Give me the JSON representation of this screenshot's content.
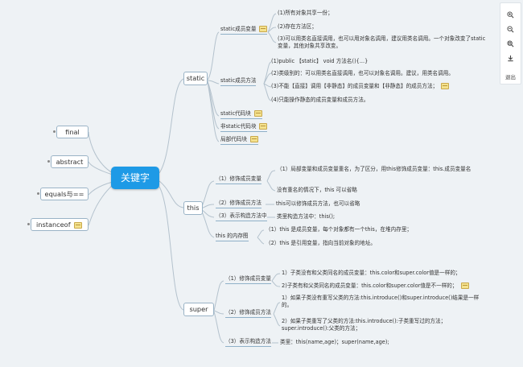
{
  "central": "关键字",
  "left_topics": [
    "final",
    "abstract",
    "equals与==",
    "instanceof"
  ],
  "static": {
    "label": "static",
    "member_var": {
      "label": "static成员变量",
      "items": [
        "(1)所有对象共享一份；",
        "(2)存在方法区；",
        "(3)可以用类名直接调用，也可以用对象名调用，建议用类名调用。一个对象改变了static变量，其他对象共享改变。"
      ]
    },
    "member_method": {
      "label": "static成员方法",
      "items": [
        "(1)public 【static】 void 方法名(){...}",
        "(2)类级别的：可以用类名直接调用，也可以对象名调用。建议，用类名调用。",
        "(3)不能【直接】调用【非静态】的成员变量和【非静态】的成员方法；",
        "(4)只能操作静态的成员变量和成员方法。"
      ]
    },
    "code_block": "static代码块",
    "nonstatic_block": "非static代码块",
    "local_block": "局部代码块"
  },
  "this": {
    "label": "this",
    "modify_var": {
      "label": "（1）修饰成员变量",
      "items": [
        "（1）局部变量和成员变量重名，为了区分，用this修饰成员变量：this.成员变量名",
        "没有重名的情况下，this 可以省略"
      ]
    },
    "modify_method": {
      "label": "（2）修饰成员方法",
      "items": [
        "this可以修饰成员方法，也可以省略"
      ]
    },
    "constructor": {
      "label": "（3）表示构造方法中",
      "items": [
        "类里构造方法中：this();"
      ]
    },
    "memory": {
      "label": "this 的内存图",
      "items": [
        "（1）this 是成员变量，每个对象都有一个this，在堆内存里；",
        "（2）this 是引用变量，指向当前对象的地址。"
      ]
    }
  },
  "super": {
    "label": "super",
    "modify_var": {
      "label": "（1）修饰成员变量",
      "items": [
        "1）子类没有和父类同名的成员变量：this.color和super.color值是一样的；",
        "2)子类有和父类同名的成员变量：this.color和super.color值是不一样的；"
      ]
    },
    "modify_method": {
      "label": "（2）修饰成员方法",
      "items": [
        "1）如果子类没有重写父类的方法:this.introduce()和super.introduce()结果是一样的。",
        "2）如果子类重写了父类的方法:this.introduce():子类重写过的方法；super.introduce():父类的方法；"
      ]
    },
    "constructor": {
      "label": "（3）表示构造方法",
      "items": [
        "类里：this(name,age)；super(name,age);"
      ]
    }
  },
  "toolbar": {
    "exit_label": "退出"
  },
  "colors": {
    "central": "#1e9ae6",
    "background": "#eef2f5",
    "line": "#b4c2cd",
    "note": "#f4e28e"
  }
}
